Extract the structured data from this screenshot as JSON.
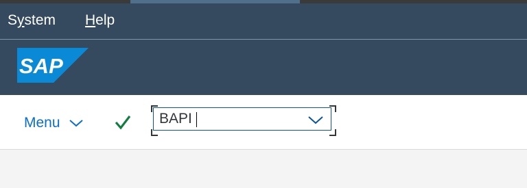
{
  "menubar": {
    "items": [
      {
        "label_prefix": "S",
        "label_underlined": "y",
        "label_suffix": "stem"
      },
      {
        "label_prefix": "",
        "label_underlined": "H",
        "label_suffix": "elp"
      }
    ]
  },
  "shell": {
    "logo_text": "SAP",
    "logo_color": "#0a8ad6",
    "background_color": "#354a5f"
  },
  "toolbar": {
    "menu_label": "Menu",
    "menu_icon": "chevron-down-icon",
    "enter_icon": "checkmark-icon",
    "enter_color": "#107e3e",
    "command_field": {
      "value": "BAPI",
      "dropdown_icon": "chevron-down-icon"
    }
  }
}
